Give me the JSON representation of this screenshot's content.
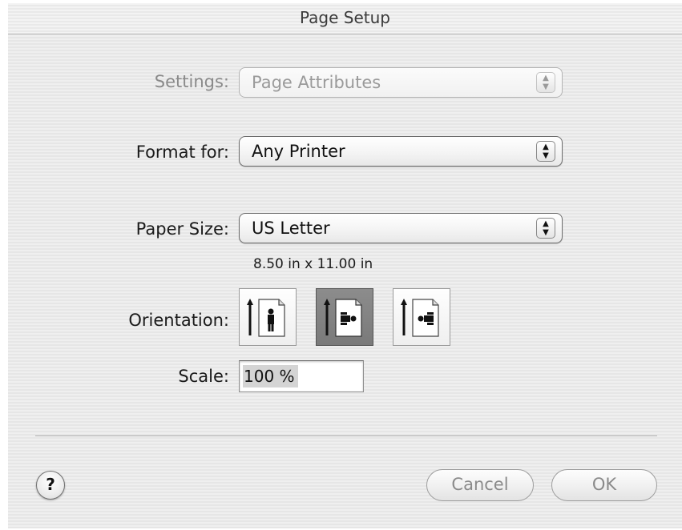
{
  "window": {
    "title": "Page Setup"
  },
  "settings": {
    "label": "Settings:",
    "value": "Page Attributes"
  },
  "format_for": {
    "label": "Format for:",
    "value": "Any Printer"
  },
  "paper_size": {
    "label": "Paper Size:",
    "value": "US Letter",
    "dimensions": "8.50 in x 11.00 in"
  },
  "orientation": {
    "label": "Orientation:",
    "options": [
      {
        "name": "portrait",
        "icon": "portrait-icon",
        "selected": false
      },
      {
        "name": "landscape-left",
        "icon": "landscape-left-icon",
        "selected": true
      },
      {
        "name": "landscape-right",
        "icon": "landscape-right-icon",
        "selected": false
      }
    ]
  },
  "scale": {
    "label": "Scale:",
    "value": "100 %"
  },
  "buttons": {
    "help": "?",
    "cancel": "Cancel",
    "ok": "OK"
  },
  "colors": {
    "window_bg": "#ececec",
    "selected_orientation": "#808080",
    "disabled_text": "#8a8a8a"
  }
}
